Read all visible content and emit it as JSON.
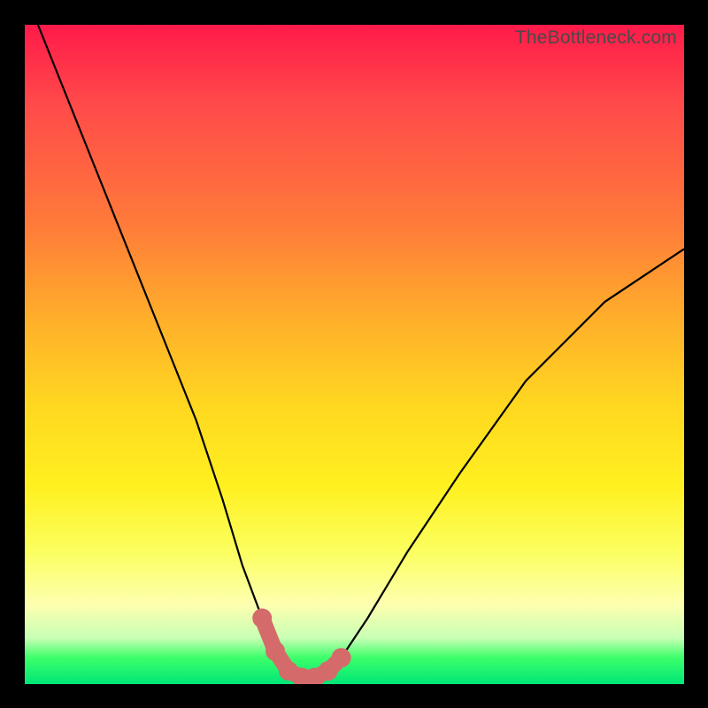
{
  "watermark": "TheBottleneck.com",
  "chart_data": {
    "type": "line",
    "title": "",
    "xlabel": "",
    "ylabel": "",
    "xlim": [
      0,
      100
    ],
    "ylim": [
      0,
      100
    ],
    "series": [
      {
        "name": "bottleneck-curve",
        "x": [
          2,
          6,
          10,
          14,
          18,
          22,
          26,
          30,
          33,
          36,
          38,
          40,
          42,
          44,
          46,
          48,
          52,
          58,
          66,
          76,
          88,
          100
        ],
        "values": [
          100,
          90,
          80,
          70,
          60,
          50,
          40,
          28,
          18,
          10,
          5,
          2,
          1,
          1,
          2,
          4,
          10,
          20,
          32,
          46,
          58,
          66
        ]
      },
      {
        "name": "highlight-segment",
        "x": [
          36,
          38,
          40,
          42,
          44,
          46,
          48
        ],
        "values": [
          10,
          5,
          2,
          1,
          1,
          2,
          4
        ]
      }
    ],
    "annotations": [],
    "legend": []
  }
}
